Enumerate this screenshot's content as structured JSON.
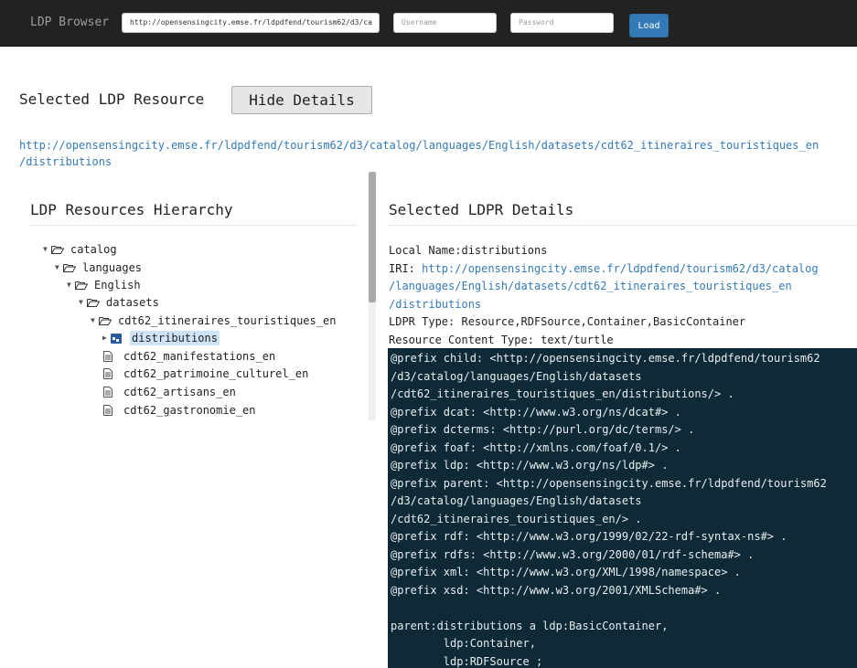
{
  "navbar": {
    "brand": "LDP Browser",
    "url_value": "http://opensensingcity.emse.fr/ldpdfend/tourism62/d3/ca",
    "username_placeholder": "Username",
    "password_placeholder": "Password",
    "load_label": "Load"
  },
  "selected": {
    "title": "Selected LDP Resource",
    "hide_label": "Hide Details",
    "url_line1": "http://opensensingcity.emse.fr/ldpdfend/tourism62/d3/catalog/languages/English/datasets/cdt62_itineraires_touristiques_en",
    "url_line2": "/distributions"
  },
  "hierarchy": {
    "title": "LDP Resources Hierarchy",
    "nodes": [
      {
        "label": "catalog",
        "type": "folder-open"
      },
      {
        "label": "languages",
        "type": "folder-open"
      },
      {
        "label": "English",
        "type": "folder-open"
      },
      {
        "label": "datasets",
        "type": "folder-open"
      },
      {
        "label": "cdt62_itineraires_touristiques_en",
        "type": "folder-open"
      },
      {
        "label": "distributions",
        "type": "folder-selected"
      },
      {
        "label": "cdt62_manifestations_en",
        "type": "file"
      },
      {
        "label": "cdt62_patrimoine_culturel_en",
        "type": "file"
      },
      {
        "label": "cdt62_artisans_en",
        "type": "file"
      },
      {
        "label": "cdt62_gastronomie_en",
        "type": "file"
      }
    ]
  },
  "details": {
    "title": "Selected LDPR Details",
    "local_name_label": "Local Name:",
    "local_name": "distributions",
    "iri_label": "IRI: ",
    "iri_line1": "http://opensensingcity.emse.fr/ldpdfend/tourism62/d3/catalog",
    "iri_line2": "/languages/English/datasets/cdt62_itineraires_touristiques_en",
    "iri_line3": "/distributions",
    "type_label": "LDPR Type: ",
    "type_value": "Resource,RDFSource,Container,BasicContainer",
    "content_type_label": "Resource Content Type: ",
    "content_type_value": "text/turtle",
    "turtle": "@prefix child: <http://opensensingcity.emse.fr/ldpdfend/tourism62\n/d3/catalog/languages/English/datasets\n/cdt62_itineraires_touristiques_en/distributions/> .\n@prefix dcat: <http://www.w3.org/ns/dcat#> .\n@prefix dcterms: <http://purl.org/dc/terms/> .\n@prefix foaf: <http://xmlns.com/foaf/0.1/> .\n@prefix ldp: <http://www.w3.org/ns/ldp#> .\n@prefix parent: <http://opensensingcity.emse.fr/ldpdfend/tourism62\n/d3/catalog/languages/English/datasets\n/cdt62_itineraires_touristiques_en/> .\n@prefix rdf: <http://www.w3.org/1999/02/22-rdf-syntax-ns#> .\n@prefix rdfs: <http://www.w3.org/2000/01/rdf-schema#> .\n@prefix xml: <http://www.w3.org/XML/1998/namespace> .\n@prefix xsd: <http://www.w3.org/2001/XMLSchema#> .\n\nparent:distributions a ldp:BasicContainer,\n        ldp:Container,\n        ldp:RDFSource ;"
  },
  "colors": {
    "navbar_bg": "#222222",
    "accent": "#337ab7",
    "turtle_bg": "#0d2a36",
    "selection_highlight": "#cfe3f7"
  }
}
